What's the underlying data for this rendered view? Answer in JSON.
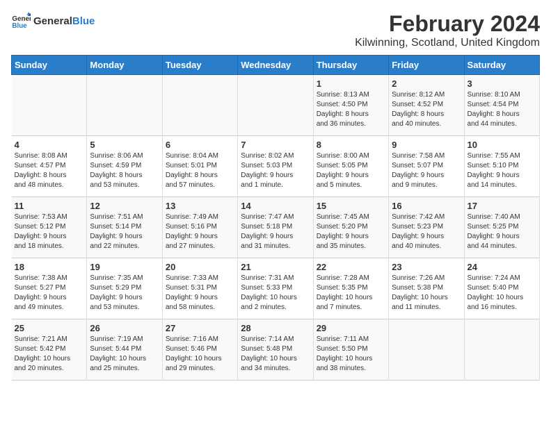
{
  "header": {
    "logo_general": "General",
    "logo_blue": "Blue",
    "main_title": "February 2024",
    "subtitle": "Kilwinning, Scotland, United Kingdom"
  },
  "days_of_week": [
    "Sunday",
    "Monday",
    "Tuesday",
    "Wednesday",
    "Thursday",
    "Friday",
    "Saturday"
  ],
  "weeks": [
    [
      {
        "day": "",
        "info": ""
      },
      {
        "day": "",
        "info": ""
      },
      {
        "day": "",
        "info": ""
      },
      {
        "day": "",
        "info": ""
      },
      {
        "day": "1",
        "info": "Sunrise: 8:13 AM\nSunset: 4:50 PM\nDaylight: 8 hours\nand 36 minutes."
      },
      {
        "day": "2",
        "info": "Sunrise: 8:12 AM\nSunset: 4:52 PM\nDaylight: 8 hours\nand 40 minutes."
      },
      {
        "day": "3",
        "info": "Sunrise: 8:10 AM\nSunset: 4:54 PM\nDaylight: 8 hours\nand 44 minutes."
      }
    ],
    [
      {
        "day": "4",
        "info": "Sunrise: 8:08 AM\nSunset: 4:57 PM\nDaylight: 8 hours\nand 48 minutes."
      },
      {
        "day": "5",
        "info": "Sunrise: 8:06 AM\nSunset: 4:59 PM\nDaylight: 8 hours\nand 53 minutes."
      },
      {
        "day": "6",
        "info": "Sunrise: 8:04 AM\nSunset: 5:01 PM\nDaylight: 8 hours\nand 57 minutes."
      },
      {
        "day": "7",
        "info": "Sunrise: 8:02 AM\nSunset: 5:03 PM\nDaylight: 9 hours\nand 1 minute."
      },
      {
        "day": "8",
        "info": "Sunrise: 8:00 AM\nSunset: 5:05 PM\nDaylight: 9 hours\nand 5 minutes."
      },
      {
        "day": "9",
        "info": "Sunrise: 7:58 AM\nSunset: 5:07 PM\nDaylight: 9 hours\nand 9 minutes."
      },
      {
        "day": "10",
        "info": "Sunrise: 7:55 AM\nSunset: 5:10 PM\nDaylight: 9 hours\nand 14 minutes."
      }
    ],
    [
      {
        "day": "11",
        "info": "Sunrise: 7:53 AM\nSunset: 5:12 PM\nDaylight: 9 hours\nand 18 minutes."
      },
      {
        "day": "12",
        "info": "Sunrise: 7:51 AM\nSunset: 5:14 PM\nDaylight: 9 hours\nand 22 minutes."
      },
      {
        "day": "13",
        "info": "Sunrise: 7:49 AM\nSunset: 5:16 PM\nDaylight: 9 hours\nand 27 minutes."
      },
      {
        "day": "14",
        "info": "Sunrise: 7:47 AM\nSunset: 5:18 PM\nDaylight: 9 hours\nand 31 minutes."
      },
      {
        "day": "15",
        "info": "Sunrise: 7:45 AM\nSunset: 5:20 PM\nDaylight: 9 hours\nand 35 minutes."
      },
      {
        "day": "16",
        "info": "Sunrise: 7:42 AM\nSunset: 5:23 PM\nDaylight: 9 hours\nand 40 minutes."
      },
      {
        "day": "17",
        "info": "Sunrise: 7:40 AM\nSunset: 5:25 PM\nDaylight: 9 hours\nand 44 minutes."
      }
    ],
    [
      {
        "day": "18",
        "info": "Sunrise: 7:38 AM\nSunset: 5:27 PM\nDaylight: 9 hours\nand 49 minutes."
      },
      {
        "day": "19",
        "info": "Sunrise: 7:35 AM\nSunset: 5:29 PM\nDaylight: 9 hours\nand 53 minutes."
      },
      {
        "day": "20",
        "info": "Sunrise: 7:33 AM\nSunset: 5:31 PM\nDaylight: 9 hours\nand 58 minutes."
      },
      {
        "day": "21",
        "info": "Sunrise: 7:31 AM\nSunset: 5:33 PM\nDaylight: 10 hours\nand 2 minutes."
      },
      {
        "day": "22",
        "info": "Sunrise: 7:28 AM\nSunset: 5:35 PM\nDaylight: 10 hours\nand 7 minutes."
      },
      {
        "day": "23",
        "info": "Sunrise: 7:26 AM\nSunset: 5:38 PM\nDaylight: 10 hours\nand 11 minutes."
      },
      {
        "day": "24",
        "info": "Sunrise: 7:24 AM\nSunset: 5:40 PM\nDaylight: 10 hours\nand 16 minutes."
      }
    ],
    [
      {
        "day": "25",
        "info": "Sunrise: 7:21 AM\nSunset: 5:42 PM\nDaylight: 10 hours\nand 20 minutes."
      },
      {
        "day": "26",
        "info": "Sunrise: 7:19 AM\nSunset: 5:44 PM\nDaylight: 10 hours\nand 25 minutes."
      },
      {
        "day": "27",
        "info": "Sunrise: 7:16 AM\nSunset: 5:46 PM\nDaylight: 10 hours\nand 29 minutes."
      },
      {
        "day": "28",
        "info": "Sunrise: 7:14 AM\nSunset: 5:48 PM\nDaylight: 10 hours\nand 34 minutes."
      },
      {
        "day": "29",
        "info": "Sunrise: 7:11 AM\nSunset: 5:50 PM\nDaylight: 10 hours\nand 38 minutes."
      },
      {
        "day": "",
        "info": ""
      },
      {
        "day": "",
        "info": ""
      }
    ]
  ]
}
